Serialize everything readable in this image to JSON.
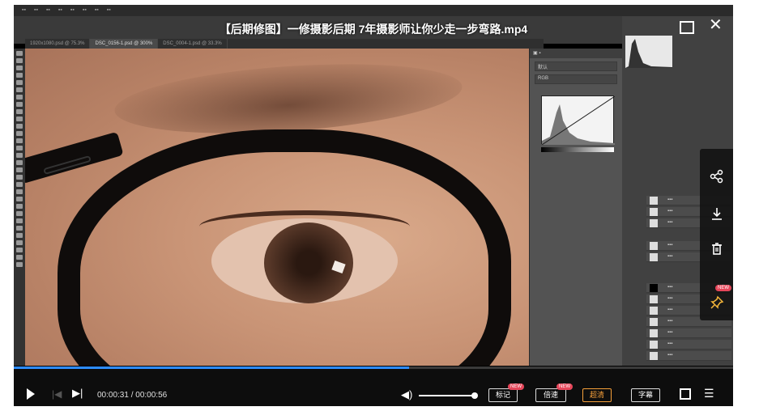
{
  "video": {
    "title": "【后期修图】一修摄影后期 7年摄影师让你少走一步弯路.mp4",
    "current_time": "00:00:31",
    "duration": "00:00:56",
    "time_display": "00:00:31 / 00:00:56",
    "progress_fraction": 0.55,
    "volume_fraction": 1.0
  },
  "controls": {
    "mark_label": "标记",
    "speed_label": "倍速",
    "quality_label": "超清",
    "subtitle_label": "字幕",
    "new_badge": "NEW"
  },
  "side_actions": {
    "new_badge": "NEW"
  },
  "photoshop": {
    "tabs": [
      "1920x1080.psd @ 75.3%",
      "DSC_0156-1.psd @ 300%",
      "DSC_0004-1.psd @ 33.3%"
    ],
    "curves_preset": "默认",
    "channel": "RGB",
    "colors": {
      "panel": "#535353",
      "dark": "#2b2b2b",
      "accent": "#2d8cff"
    }
  },
  "icons": {
    "play": "play-icon",
    "prev": "skip-back-icon",
    "next": "skip-forward-icon",
    "volume": "volume-icon",
    "fullscreen": "fullscreen-icon",
    "menu": "menu-icon",
    "share": "share-icon",
    "download": "download-icon",
    "delete": "trash-icon",
    "pin": "pin-icon"
  }
}
